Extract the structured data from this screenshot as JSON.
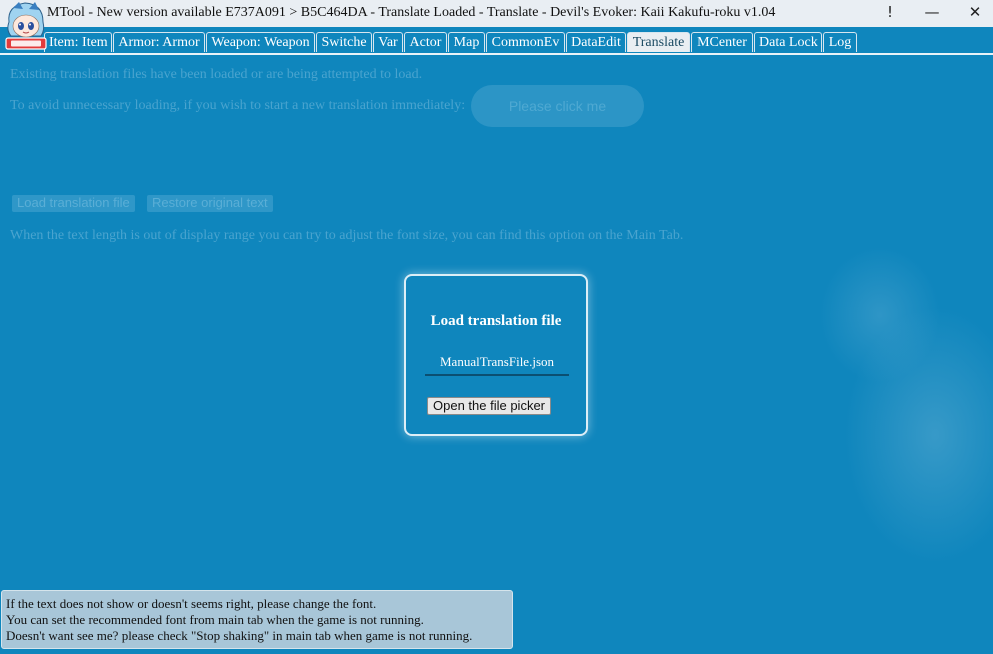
{
  "window": {
    "title": "MTool - New version available E737A091 > B5C464DA - Translate Loaded - Translate - Devil's Evoker: Kaii Kakufu-roku v1.04",
    "controls": {
      "alert": "!",
      "minimize": "—",
      "close": "✕"
    }
  },
  "tabs": [
    {
      "label": "Item: Item"
    },
    {
      "label": "Armor: Armor"
    },
    {
      "label": "Weapon: Weapon"
    },
    {
      "label": "Switche"
    },
    {
      "label": "Var"
    },
    {
      "label": "Actor"
    },
    {
      "label": "Map"
    },
    {
      "label": "CommonEv"
    },
    {
      "label": "DataEdit"
    },
    {
      "label": "Translate"
    },
    {
      "label": "MCenter"
    },
    {
      "label": "Data Lock"
    },
    {
      "label": "Log"
    }
  ],
  "active_tab": "Translate",
  "translate": {
    "info_line": "Existing translation files have been loaded or are being attempted to load.",
    "new_translation_prompt": "To avoid unnecessary loading, if you wish to start a new translation immediately:",
    "please_click_label": "Please click me",
    "load_button": "Load translation file",
    "restore_button": "Restore original text",
    "font_hint": "When the text length is out of display range you can try to adjust the font size, you can find this option on the Main Tab."
  },
  "dialog": {
    "title": "Load translation file",
    "file_value": "ManualTransFile.json",
    "picker_button": "Open the file picker"
  },
  "notice": {
    "line1": "If the text does not show or doesn't seems right, please change the font.",
    "line2": "You can set the recommended font from main tab when the game is not running.",
    "line3": "Doesn't want see me? please check \"Stop shaking\" in main tab when game is not running."
  },
  "colors": {
    "background": "#0f86bd",
    "active_tab": "#e9eef2",
    "notice_bg": "#a8c6d8"
  }
}
